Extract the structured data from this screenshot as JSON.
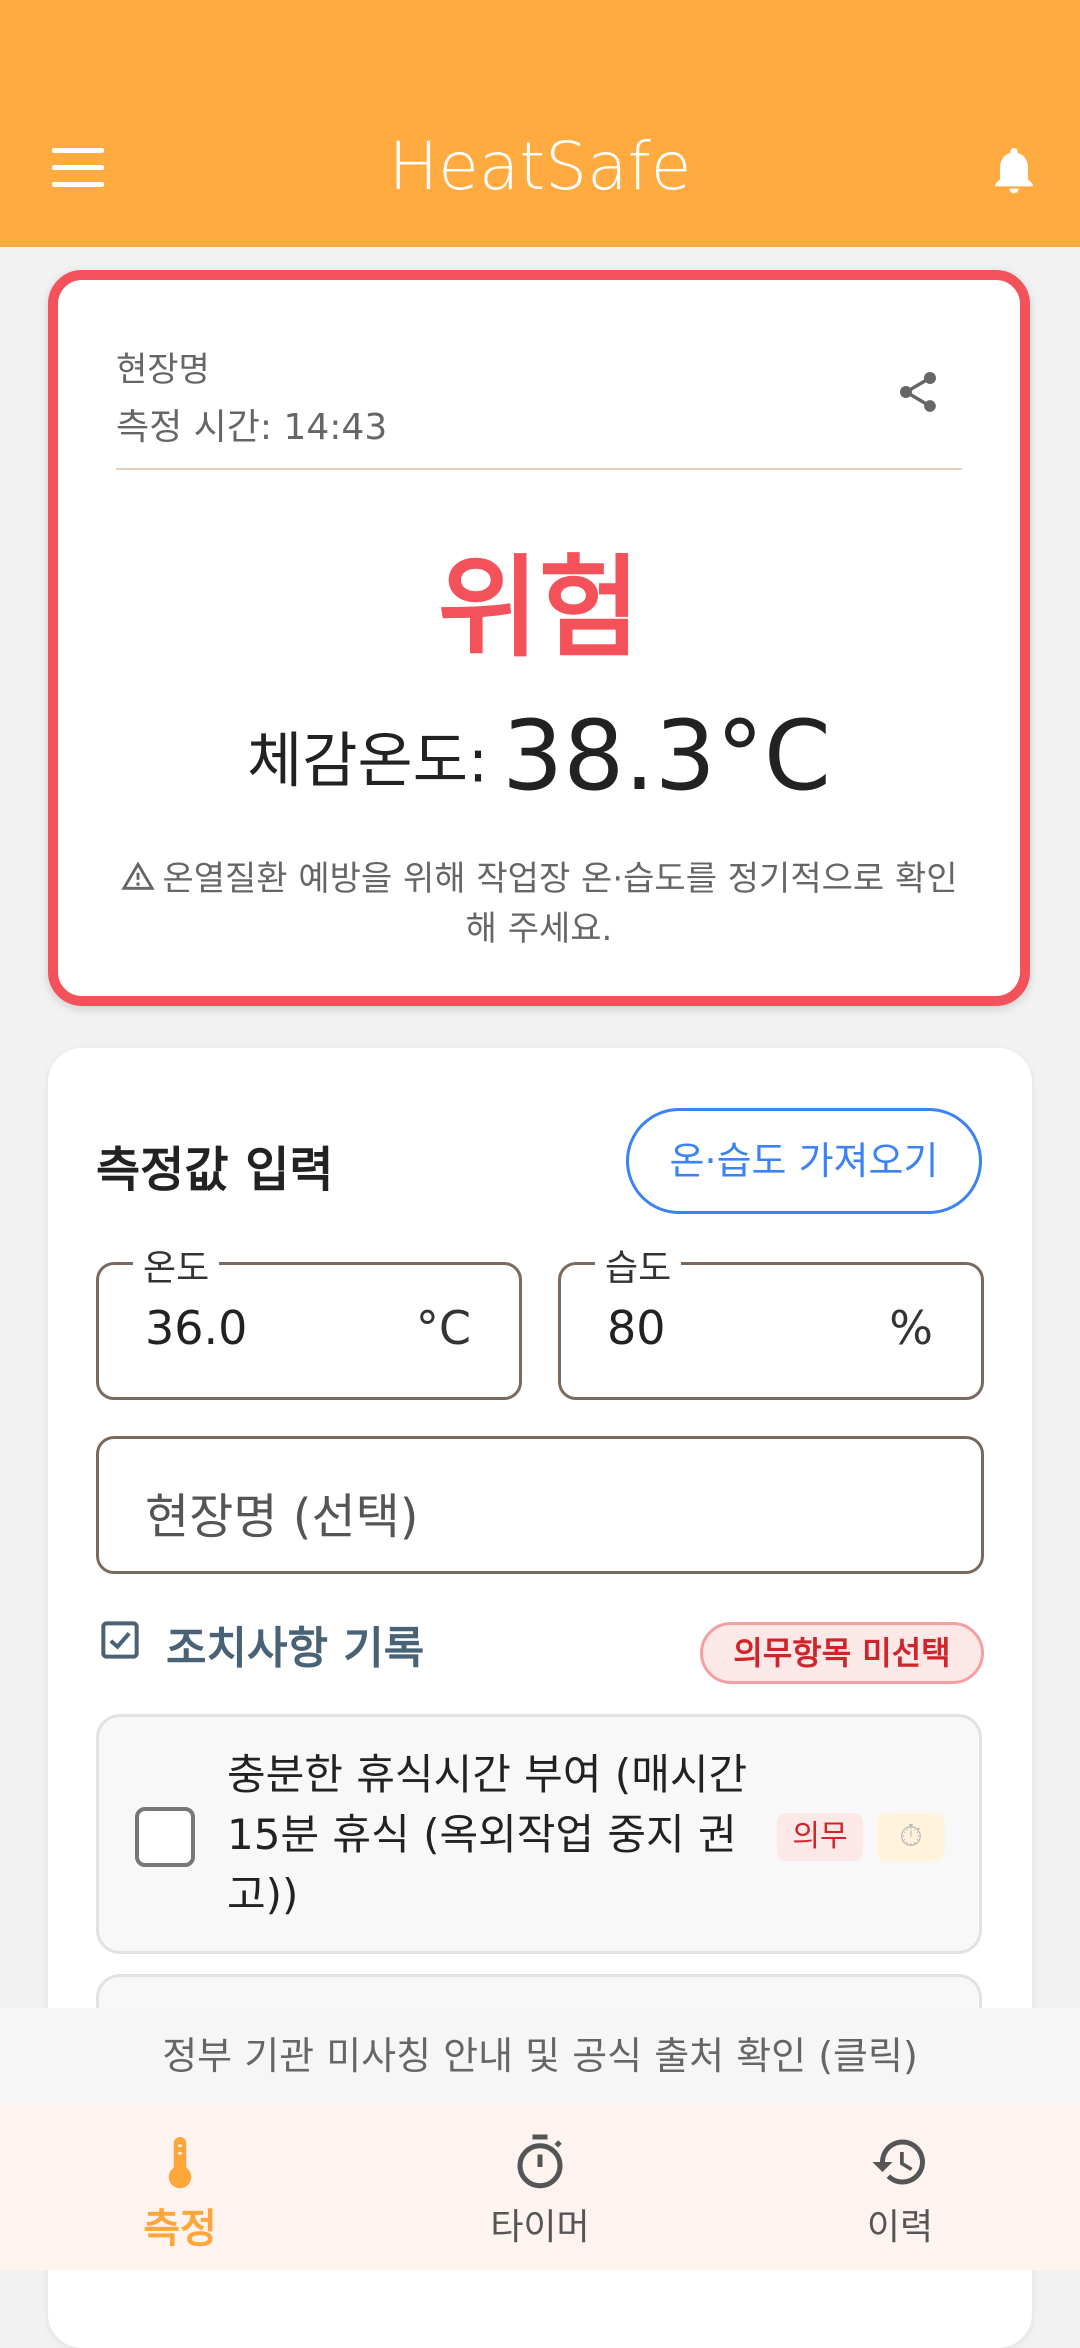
{
  "app_bar": {
    "title": "HeatSafe",
    "menu_icon": "menu-icon",
    "notification_icon": "bell-icon"
  },
  "status_card": {
    "site_name": "현장명",
    "measured_time": "측정 시간: 14:43",
    "share_icon": "share-icon",
    "risk_level": "위험",
    "feels_like_label": "체감온도:",
    "feels_like_value": "38.3°C",
    "warning_text": "온열질환 예방을 위해 작업장 온·습도를 정기적으로 확인해 주세요.",
    "colors": {
      "danger": "#f4525a"
    }
  },
  "input_card": {
    "heading": "측정값 입력",
    "fetch_button": "온·습도 가져오기",
    "temperature": {
      "label": "온도",
      "value": "36.0",
      "unit": "°C"
    },
    "humidity": {
      "label": "습도",
      "value": "80",
      "unit": "%"
    },
    "site_field": {
      "placeholder": "현장명 (선택)"
    },
    "actions": {
      "label": "조치사항 기록",
      "missing_badge": "의무항목 미선택",
      "items": [
        {
          "text": "충분한 휴식시간 부여 (매시간 15분 휴식 (옥외작업 중지 권고))",
          "tag": "의무",
          "timer_icon": "stopwatch-icon",
          "checked": false
        }
      ]
    }
  },
  "notice_bar": {
    "text": "정부 기관 미사칭 안내 및 공식 출처 확인 (클릭)"
  },
  "bottom_nav": {
    "items": [
      {
        "label": "측정",
        "icon": "thermometer-icon",
        "active": true
      },
      {
        "label": "타이머",
        "icon": "stopwatch-icon",
        "active": false
      },
      {
        "label": "이력",
        "icon": "history-icon",
        "active": false
      }
    ],
    "colors": {
      "active": "#ffa53a"
    }
  }
}
